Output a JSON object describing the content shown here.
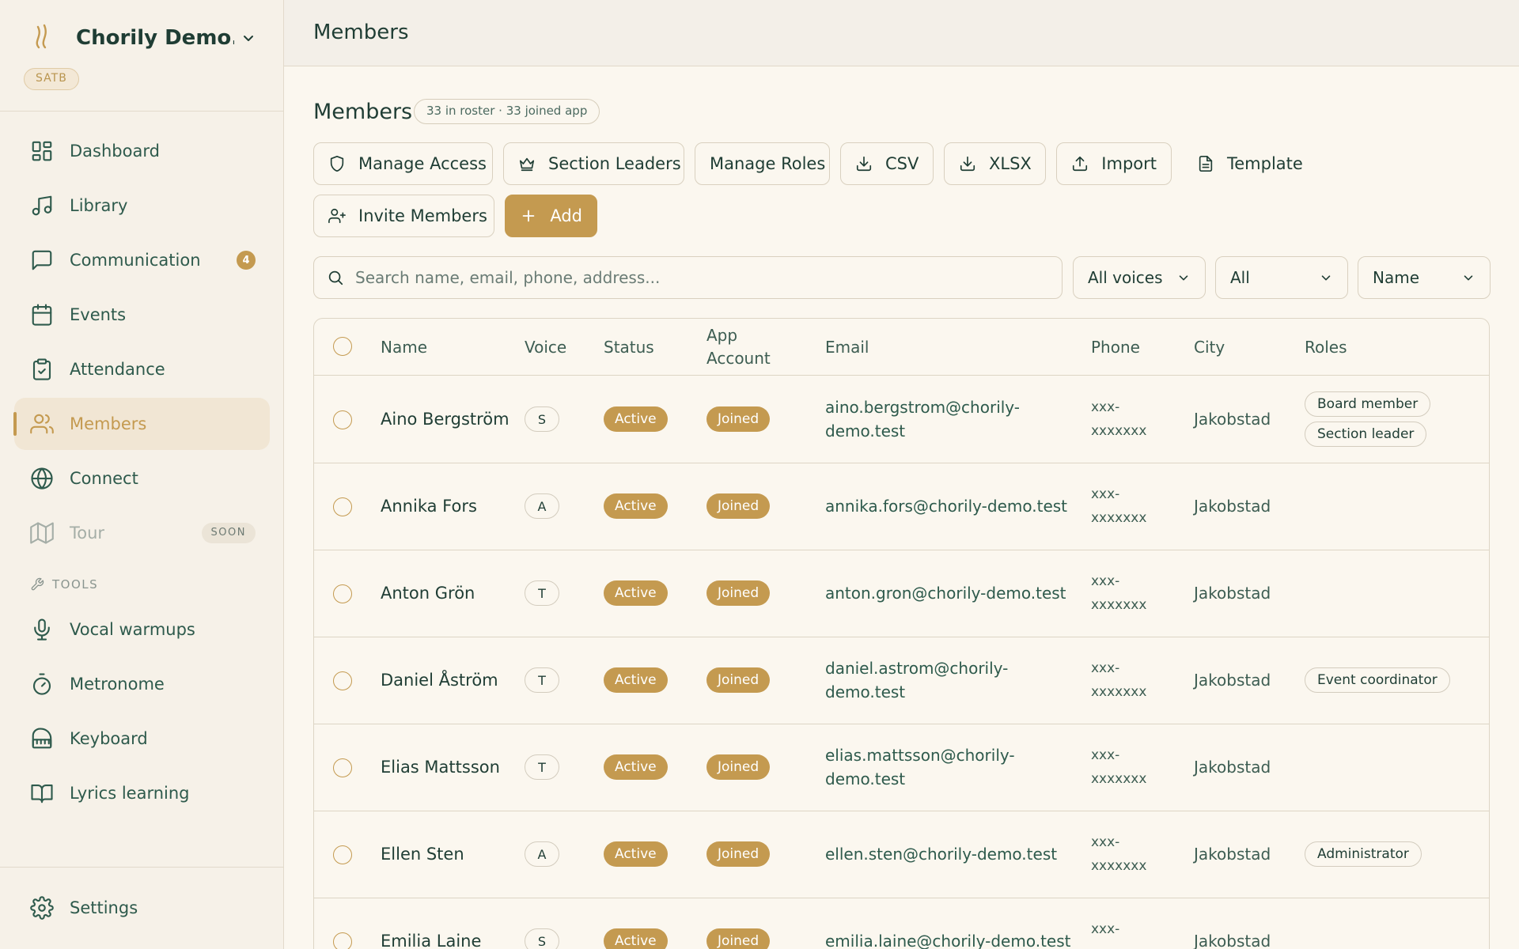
{
  "sidebar": {
    "brand": {
      "name": "Chorily Demo...",
      "badge": "SATB"
    },
    "nav": [
      {
        "id": "dashboard",
        "label": "Dashboard",
        "icon": "dashboard-icon"
      },
      {
        "id": "library",
        "label": "Library",
        "icon": "music-note-icon"
      },
      {
        "id": "communication",
        "label": "Communication",
        "icon": "chat-icon",
        "badge": "4"
      },
      {
        "id": "events",
        "label": "Events",
        "icon": "calendar-icon"
      },
      {
        "id": "attendance",
        "label": "Attendance",
        "icon": "clipboard-check-icon"
      },
      {
        "id": "members",
        "label": "Members",
        "icon": "users-icon",
        "active": true
      },
      {
        "id": "connect",
        "label": "Connect",
        "icon": "globe-icon"
      },
      {
        "id": "tour",
        "label": "Tour",
        "icon": "map-icon",
        "badge": "SOON",
        "disabled": true
      }
    ],
    "tools_heading": "TOOLS",
    "tools": [
      {
        "id": "vocal-warmups",
        "label": "Vocal warmups",
        "icon": "microphone-icon"
      },
      {
        "id": "metronome",
        "label": "Metronome",
        "icon": "timer-icon"
      },
      {
        "id": "keyboard",
        "label": "Keyboard",
        "icon": "piano-icon"
      },
      {
        "id": "lyrics-learning",
        "label": "Lyrics learning",
        "icon": "book-icon"
      }
    ],
    "settings_label": "Settings"
  },
  "topbar": {
    "title": "Members"
  },
  "main": {
    "title": "Members",
    "count": "33 in roster · 33 joined app",
    "actions": {
      "manage_access": "Manage Access",
      "section_leaders": "Section Leaders",
      "manage_roles": "Manage Roles",
      "csv": "CSV",
      "xlsx": "XLSX",
      "import": "Import",
      "template": "Template",
      "invite_members": "Invite Members",
      "add": "Add"
    },
    "search": {
      "placeholder": "Search name, email, phone, address..."
    },
    "filters": {
      "voice": "All voices",
      "status": "All",
      "sort": "Name"
    }
  },
  "table": {
    "columns": {
      "name": "Name",
      "voice": "Voice",
      "status": "Status",
      "app_account": "App Account",
      "email": "Email",
      "phone": "Phone",
      "city": "City",
      "roles": "Roles"
    },
    "rows": [
      {
        "name": "Aino Bergström",
        "voice": "S",
        "status": "Active",
        "app": "Joined",
        "email": "aino.bergstrom@chorily-demo.test",
        "phone": "xxx-xxxxxxx",
        "city": "Jakobstad",
        "roles": [
          "Board member",
          "Section leader"
        ]
      },
      {
        "name": "Annika Fors",
        "voice": "A",
        "status": "Active",
        "app": "Joined",
        "email": "annika.fors@chorily-demo.test",
        "phone": "xxx-xxxxxxx",
        "city": "Jakobstad",
        "roles": []
      },
      {
        "name": "Anton Grön",
        "voice": "T",
        "status": "Active",
        "app": "Joined",
        "email": "anton.gron@chorily-demo.test",
        "phone": "xxx-xxxxxxx",
        "city": "Jakobstad",
        "roles": []
      },
      {
        "name": "Daniel Åström",
        "voice": "T",
        "status": "Active",
        "app": "Joined",
        "email": "daniel.astrom@chorily-demo.test",
        "phone": "xxx-xxxxxxx",
        "city": "Jakobstad",
        "roles": [
          "Event coordinator"
        ]
      },
      {
        "name": "Elias Mattsson",
        "voice": "T",
        "status": "Active",
        "app": "Joined",
        "email": "elias.mattsson@chorily-demo.test",
        "phone": "xxx-xxxxxxx",
        "city": "Jakobstad",
        "roles": []
      },
      {
        "name": "Ellen Sten",
        "voice": "A",
        "status": "Active",
        "app": "Joined",
        "email": "ellen.sten@chorily-demo.test",
        "phone": "xxx-xxxxxxx",
        "city": "Jakobstad",
        "roles": [
          "Administrator"
        ]
      },
      {
        "name": "Emilia Laine",
        "voice": "S",
        "status": "Active",
        "app": "Joined",
        "email": "emilia.laine@chorily-demo.test",
        "phone": "xxx-xxxxxxx",
        "city": "Jakobstad",
        "roles": []
      }
    ]
  },
  "colors": {
    "accent": "#c49a50",
    "text": "#1f3d34",
    "sidebar_bg": "#f6f1e8",
    "page_bg": "#fbf7ef",
    "border": "#ddd5c5"
  }
}
